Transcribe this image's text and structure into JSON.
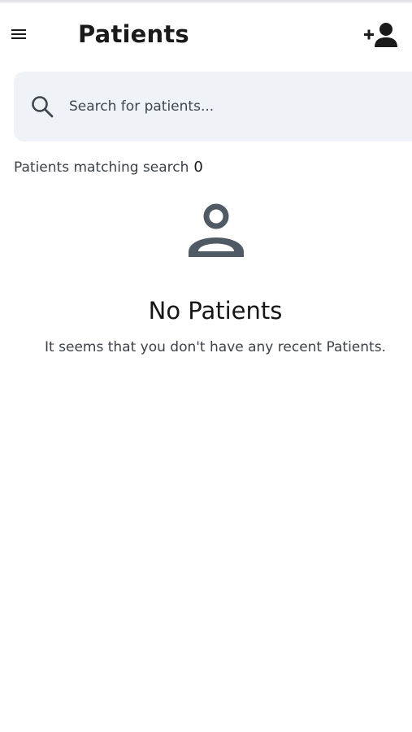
{
  "header": {
    "title": "Patients",
    "menu_icon": "hamburger-menu-icon",
    "add_icon": "add-person-icon"
  },
  "search": {
    "placeholder": "Search for patients...",
    "value": "",
    "icon": "search-icon"
  },
  "results": {
    "label": "Patients matching search",
    "count": "0"
  },
  "empty_state": {
    "icon": "person-icon",
    "title": "No Patients",
    "message": "It seems that you don't have any recent Patients."
  },
  "colors": {
    "search_background": "#eff3f8",
    "icon_gray": "#4f5a65",
    "text_primary": "#1a1a1a",
    "text_secondary": "#3c4249"
  }
}
